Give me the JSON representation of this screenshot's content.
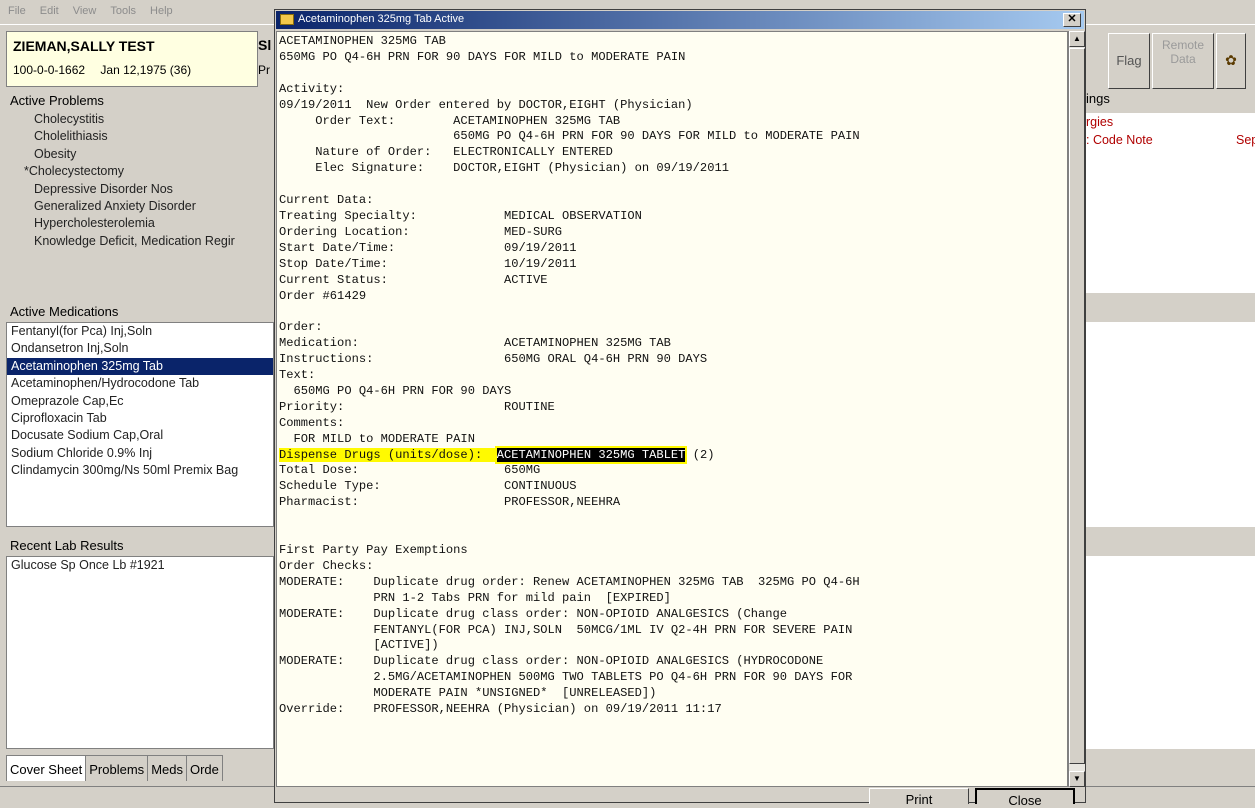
{
  "menu": [
    "File",
    "Edit",
    "View",
    "Tools",
    "Help"
  ],
  "patient": {
    "name": "ZIEMAN,SALLY TEST",
    "ssn": "100-0-0-1662",
    "dob": "Jan 12,1975 (36)",
    "stub1": "Sl",
    "stub2": "Pr"
  },
  "problems": {
    "header": "Active Problems",
    "items": [
      "Cholecystitis",
      "Cholelithiasis",
      "Obesity",
      "*Cholecystectomy",
      "Depressive Disorder Nos",
      "Generalized Anxiety Disorder",
      "Hypercholesterolemia",
      "Knowledge Deficit, Medication Regir"
    ]
  },
  "medications": {
    "header": "Active Medications",
    "items": [
      "Fentanyl(for Pca) Inj,Soln",
      "Ondansetron Inj,Soln",
      "Acetaminophen 325mg Tab",
      "Acetaminophen/Hydrocodone Tab",
      "Omeprazole Cap,Ec",
      "Ciprofloxacin Tab",
      "Docusate Sodium Cap,Oral",
      "Sodium Chloride 0.9% Inj",
      "Clindamycin 300mg/Ns 50ml Premix Bag"
    ],
    "selected_index": 2
  },
  "labs": {
    "header": "Recent Lab Results",
    "items": [
      "Glucose Sp Once Lb #1921"
    ]
  },
  "tabs": [
    "Cover Sheet",
    "Problems",
    "Meds",
    "Orde"
  ],
  "right_pane": {
    "flag": "Flag",
    "remote_l1": "Remote",
    "remote_l2": "Data",
    "postings_header": "ings",
    "allergies": "rgies",
    "code_note": ": Code Note",
    "date": "Sep"
  },
  "dialog": {
    "title": "Acetaminophen 325mg Tab Active",
    "text_before": "ACETAMINOPHEN 325MG TAB\n650MG PO Q4-6H PRN FOR 90 DAYS FOR MILD to MODERATE PAIN\n\nActivity:\n09/19/2011  New Order entered by DOCTOR,EIGHT (Physician)\n     Order Text:        ACETAMINOPHEN 325MG TAB\n                        650MG PO Q4-6H PRN FOR 90 DAYS FOR MILD to MODERATE PAIN\n     Nature of Order:   ELECTRONICALLY ENTERED\n     Elec Signature:    DOCTOR,EIGHT (Physician) on 09/19/2011\n\nCurrent Data:\nTreating Specialty:            MEDICAL OBSERVATION\nOrdering Location:             MED-SURG\nStart Date/Time:               09/19/2011\nStop Date/Time:                10/19/2011\nCurrent Status:                ACTIVE\nOrder #61429\n\nOrder:\nMedication:                    ACETAMINOPHEN 325MG TAB\nInstructions:                  650MG ORAL Q4-6H PRN 90 DAYS\nText:\n  650MG PO Q4-6H PRN FOR 90 DAYS\nPriority:                      ROUTINE\nComments:\n  FOR MILD to MODERATE PAIN\n",
    "dispense_label": "Dispense Drugs (units/dose):  ",
    "dispense_drug": "ACETAMINOPHEN 325MG TABLET",
    "dispense_qty": " (2)",
    "text_after": "Total Dose:                    650MG\nSchedule Type:                 CONTINUOUS\nPharmacist:                    PROFESSOR,NEEHRA\n\n\nFirst Party Pay Exemptions\nOrder Checks:\nMODERATE:    Duplicate drug order: Renew ACETAMINOPHEN 325MG TAB  325MG PO Q4-6H\n             PRN 1-2 Tabs PRN for mild pain  [EXPIRED]\nMODERATE:    Duplicate drug class order: NON-OPIOID ANALGESICS (Change\n             FENTANYL(FOR PCA) INJ,SOLN  50MCG/1ML IV Q2-4H PRN FOR SEVERE PAIN\n             [ACTIVE])\nMODERATE:    Duplicate drug class order: NON-OPIOID ANALGESICS (HYDROCODONE\n             2.5MG/ACETAMINOPHEN 500MG TWO TABLETS PO Q4-6H PRN FOR 90 DAYS FOR\n             MODERATE PAIN *UNSIGNED*  [UNRELEASED])\nOverride:    PROFESSOR,NEEHRA (Physician) on 09/19/2011 11:17",
    "print_label": "Print",
    "close_label": "Close",
    "close_x": "✕"
  },
  "colors": {
    "title_start": "#0a246a",
    "title_end": "#a6caf0",
    "highlight": "#fffa00",
    "alert_red": "#b00000"
  }
}
